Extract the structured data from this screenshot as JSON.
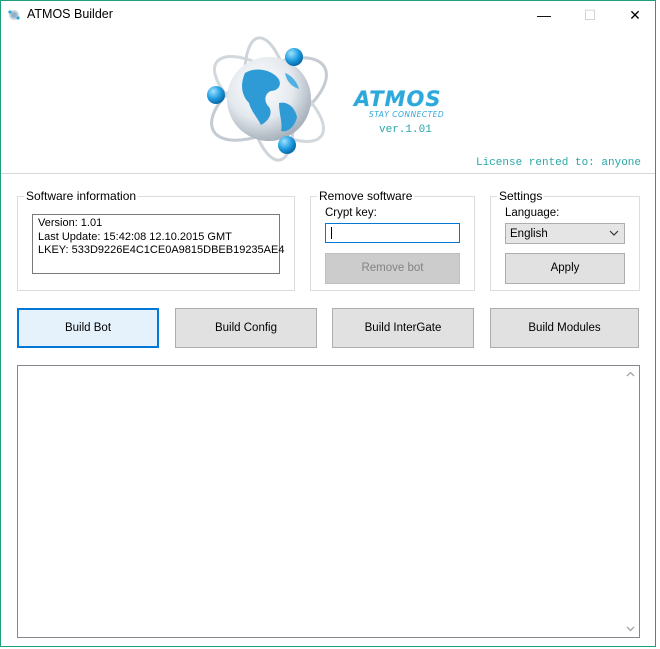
{
  "window": {
    "title": "ATMOS Builder",
    "controls": {
      "minimize": "—",
      "maximize": "☐",
      "close": "✕"
    }
  },
  "banner": {
    "brand": "ATMOS",
    "tagline": "STAY CONNECTED",
    "version": "ver.1.01",
    "license": "License rented to: anyone"
  },
  "software_info": {
    "legend": "Software information",
    "lines": [
      "Version: 1.01",
      "Last Update: 15:42:08 12.10.2015 GMT",
      "LKEY: 533D9226E4C1CE0A9815DBEB19235AE4"
    ]
  },
  "remove_software": {
    "legend": "Remove software",
    "crypt_label": "Crypt key:",
    "crypt_value": "",
    "remove_button": "Remove bot"
  },
  "settings": {
    "legend": "Settings",
    "language_label": "Language:",
    "language_value": "English",
    "apply_button": "Apply"
  },
  "actions": [
    {
      "label": "Build Bot"
    },
    {
      "label": "Build Config"
    },
    {
      "label": "Build InterGate"
    },
    {
      "label": "Build Modules"
    }
  ],
  "output": {
    "text": ""
  },
  "colors": {
    "accent": "#0078d7",
    "brand": "#2ea7da",
    "license_text": "#2aa7a7",
    "window_border": "#1e9e7a"
  },
  "icons": [
    "app-icon",
    "globe-logo",
    "chevron-down-icon",
    "scroll-up-icon",
    "scroll-down-icon"
  ]
}
